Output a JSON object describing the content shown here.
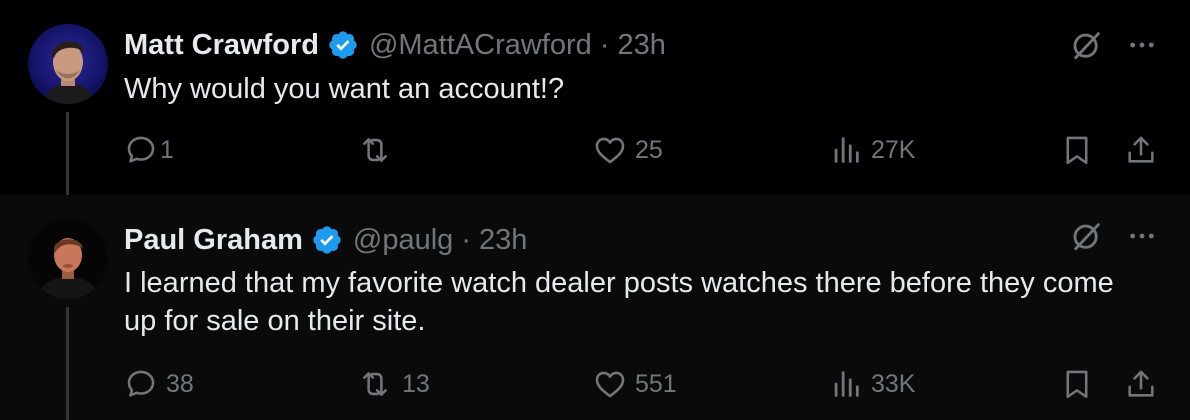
{
  "tweets": [
    {
      "name": "Matt Crawford",
      "handle": "@MattACrawford",
      "separator": "·",
      "time": "23h",
      "text": "Why would you want an account!?",
      "replies": "1",
      "retweets": "",
      "likes": "25",
      "views": "27K"
    },
    {
      "name": "Paul Graham",
      "handle": "@paulg",
      "separator": "·",
      "time": "23h",
      "text": "I learned that my favorite watch dealer posts watches there before they come up for sale on their site.",
      "replies": "38",
      "retweets": "13",
      "likes": "551",
      "views": "33K"
    }
  ],
  "colors": {
    "background": "#000000",
    "text": "#e7e9ea",
    "muted": "#71767b",
    "verified": "#1d9bf0"
  },
  "icons": [
    "verified-badge-icon",
    "grok-icon",
    "more-icon",
    "reply-icon",
    "retweet-icon",
    "like-icon",
    "views-icon",
    "bookmark-icon",
    "share-icon"
  ]
}
